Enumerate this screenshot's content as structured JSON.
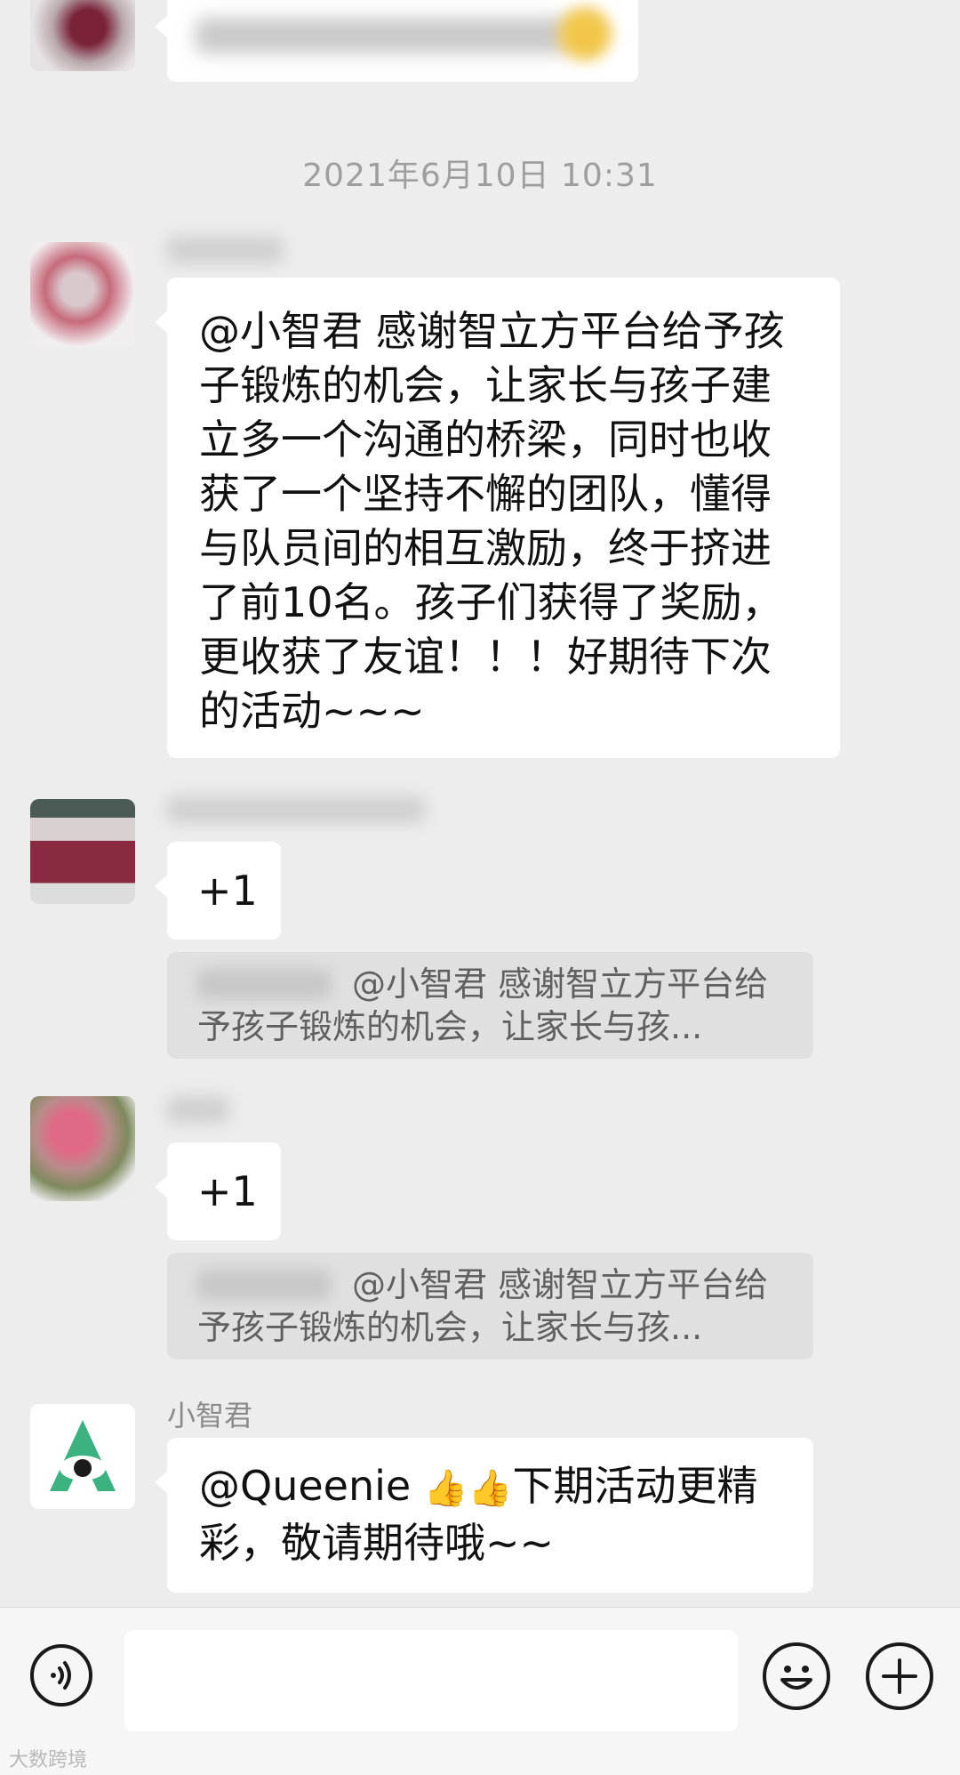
{
  "chat": {
    "timestamp": "2021年6月10日 10:31",
    "top_message": {
      "text": "",
      "blurred": true
    },
    "messages": [
      {
        "sender": "",
        "text": "@小智君 感谢智立方平台给予孩子锻炼的机会，让家长与孩子建立多一个沟通的桥梁，同时也收获了一个坚持不懈的团队，懂得与队员间的相互激励，终于挤进了前10名。孩子们获得了奖励，更收获了友谊！！！好期待下次的活动~~~"
      },
      {
        "sender": "",
        "text": "+1",
        "quote": "@小智君 感谢智立方平台给予孩子锻炼的机会，让家长与孩..."
      },
      {
        "sender": "",
        "text": "+1",
        "quote": "@小智君 感谢智立方平台给予孩子锻炼的机会，让家长与孩..."
      },
      {
        "sender": "小智君",
        "text_before_emoji": "@Queenie ",
        "emoji": "👍👍",
        "text_after_emoji": "下期活动更精彩，敬请期待哦~~"
      }
    ]
  },
  "input_bar": {
    "voice_icon": "voice-icon",
    "emoji_icon": "smiley-icon",
    "plus_icon": "plus-icon",
    "placeholder": ""
  },
  "watermark": "大数跨境",
  "colors": {
    "background": "#ededed",
    "bubble": "#ffffff",
    "quote": "#e0e0e0",
    "brand_green": "#3bb27f"
  }
}
